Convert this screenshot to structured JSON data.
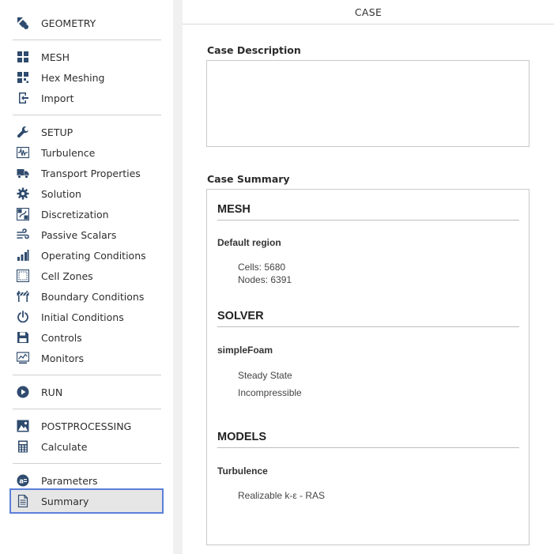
{
  "sidebar": {
    "geometry": "GEOMETRY",
    "mesh": "MESH",
    "hex_meshing": "Hex Meshing",
    "import": "Import",
    "setup": "SETUP",
    "turbulence": "Turbulence",
    "transport_properties": "Transport Properties",
    "solution": "Solution",
    "discretization": "Discretization",
    "passive_scalars": "Passive Scalars",
    "operating_conditions": "Operating Conditions",
    "cell_zones": "Cell Zones",
    "boundary_conditions": "Boundary Conditions",
    "initial_conditions": "Initial Conditions",
    "controls": "Controls",
    "monitors": "Monitors",
    "run": "RUN",
    "postprocessing": "POSTPROCESSING",
    "calculate": "Calculate",
    "parameters": "Parameters",
    "summary": "Summary",
    "active_item": "Summary",
    "accent_color": "#5b7fd9"
  },
  "main": {
    "title": "CASE",
    "case_description_label": "Case Description",
    "case_description_value": "",
    "case_summary_label": "Case Summary",
    "summary": {
      "mesh": {
        "title": "MESH",
        "region": "Default region",
        "cells": "Cells: 5680",
        "nodes": "Nodes: 6391"
      },
      "solver": {
        "title": "SOLVER",
        "name": "simpleFoam",
        "time": "Steady State",
        "flow": "Incompressible"
      },
      "models": {
        "title": "MODELS",
        "turbulence_label": "Turbulence",
        "turbulence_model": "Realizable k-ε - RAS"
      }
    }
  }
}
